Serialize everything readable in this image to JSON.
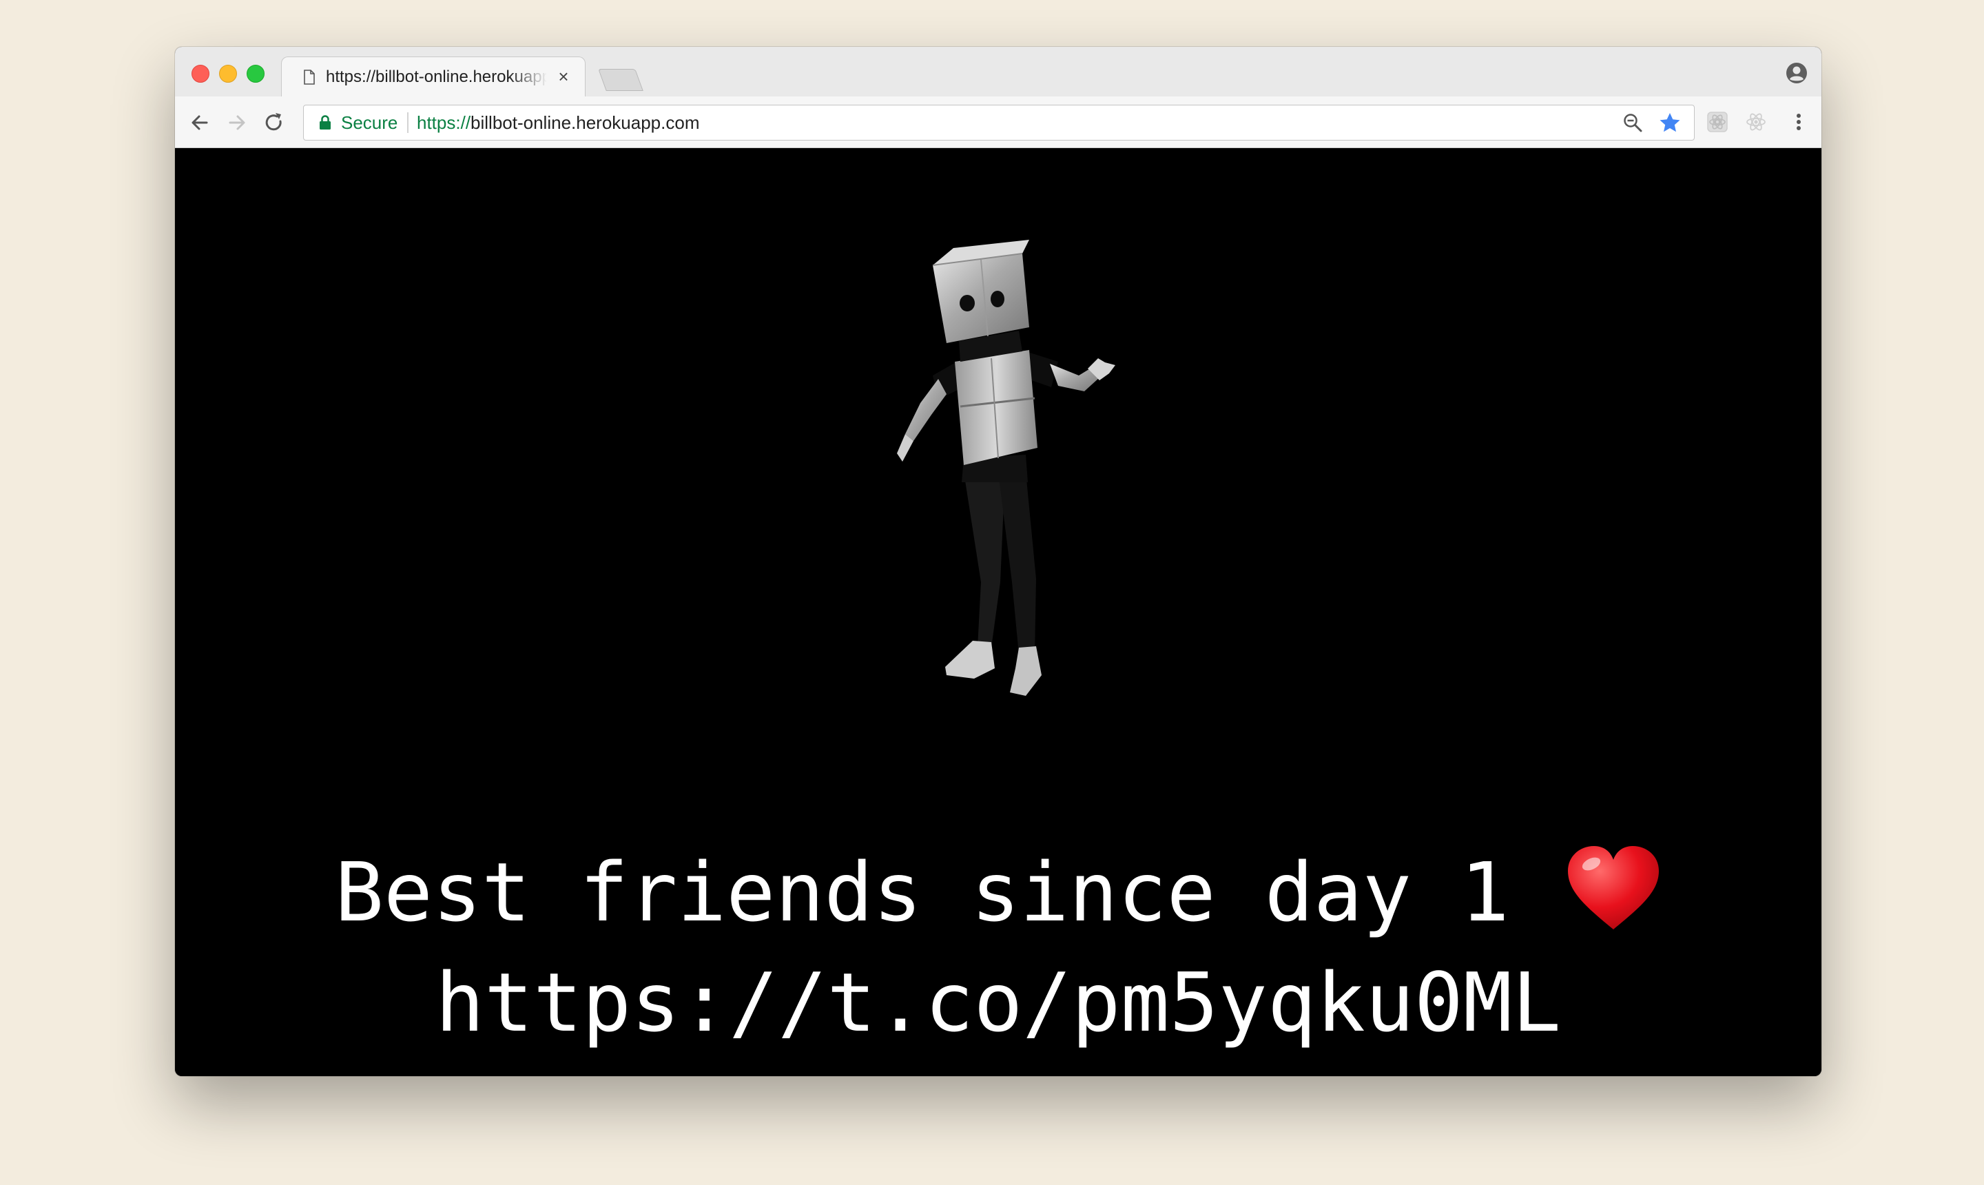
{
  "browser": {
    "tab": {
      "title": "https://billbot-online.herokuapp.com",
      "close_glyph": "×"
    },
    "toolbar": {
      "secure_label": "Secure",
      "url_scheme": "https://",
      "url_rest": "billbot-online.herokuapp.com"
    },
    "icons": [
      "page-icon",
      "close-icon",
      "new-tab-button",
      "profile-icon",
      "back-icon",
      "forward-icon",
      "reload-icon",
      "lock-icon",
      "zoom-icon",
      "bookmark-star-icon",
      "extension-icon",
      "react-devtools-icon",
      "menu-icon"
    ],
    "colors": {
      "secure_green": "#0b8043",
      "star_blue": "#4285f4",
      "page_background": "#000000",
      "desktop_background": "#f3ecde"
    }
  },
  "page": {
    "figure": "robot-costume-figure",
    "caption_line1": "Best friends since day 1",
    "caption_line2": "https://t.co/pm5yqku0ML",
    "heart_emoji": "❤️"
  }
}
